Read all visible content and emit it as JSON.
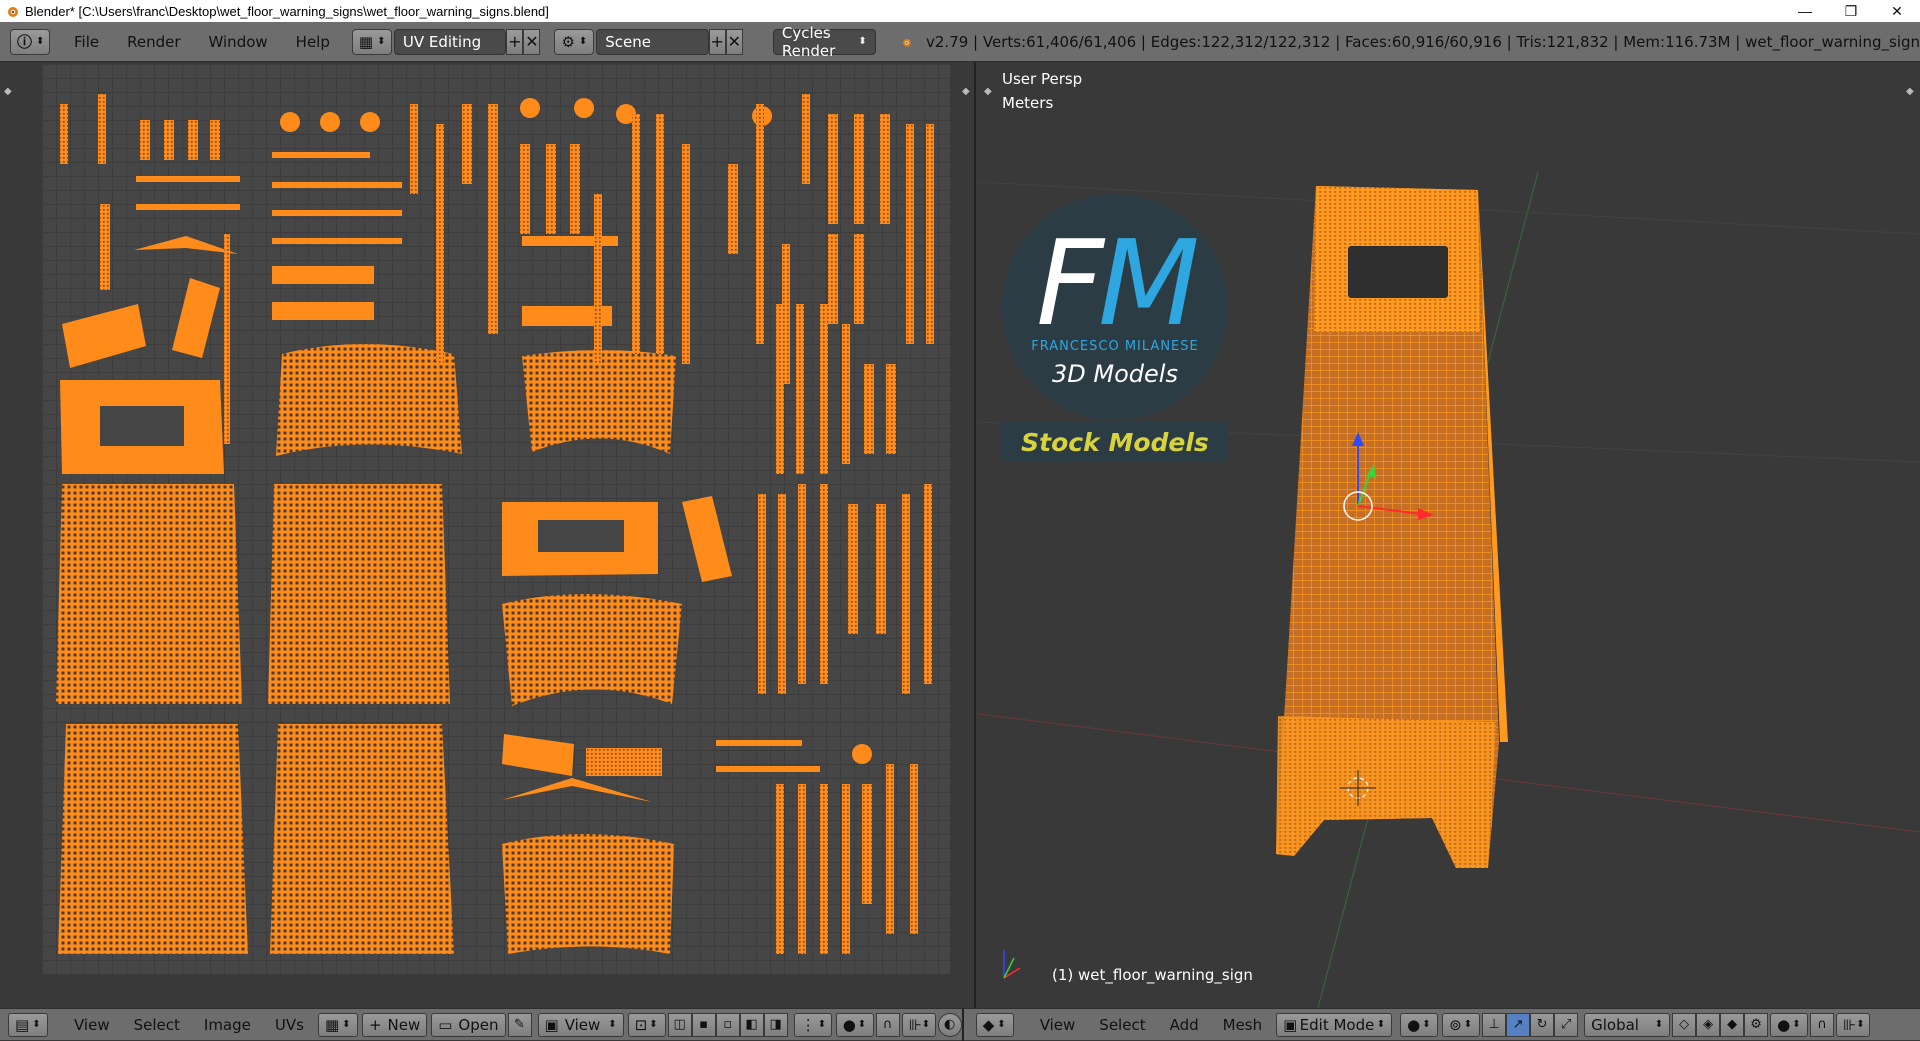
{
  "window": {
    "title": "Blender* [C:\\Users\\franc\\Desktop\\wet_floor_warning_signs\\wet_floor_warning_signs.blend]",
    "minimize": "—",
    "maximize": "❐",
    "close": "✕"
  },
  "topbar": {
    "menus": [
      "File",
      "Render",
      "Window",
      "Help"
    ],
    "layout": "UV Editing",
    "scene": "Scene",
    "engine": "Cycles Render",
    "stats": "v2.79 | Verts:61,406/61,406 | Edges:122,312/122,312 | Faces:60,916/60,916 | Tris:121,832 | Mem:116.73M | wet_floor_warning_sign"
  },
  "viewport": {
    "view_name": "User Persp",
    "units": "Meters",
    "object_label": "(1) wet_floor_warning_sign"
  },
  "logo": {
    "f": "F",
    "m": "M",
    "name": "FRANCESCO MILANESE",
    "models": "3D Models",
    "stock": "Stock Models"
  },
  "uv_bottombar": {
    "menus": [
      "View",
      "Select",
      "Image",
      "UVs"
    ],
    "new": "New",
    "open": "Open",
    "view": "View"
  },
  "vp_bottombar": {
    "menus": [
      "View",
      "Select",
      "Add",
      "Mesh"
    ],
    "mode": "Edit Mode",
    "orientation": "Global"
  },
  "colors": {
    "wire": "#ff8c1a",
    "accent": "#2ea7e0",
    "stock": "#d7d23e"
  }
}
